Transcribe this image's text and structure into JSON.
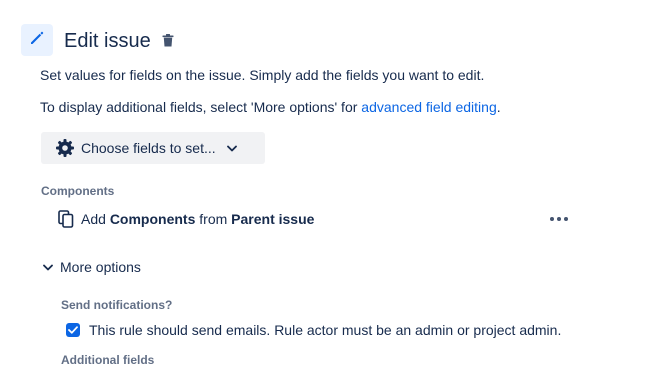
{
  "header": {
    "title": "Edit issue",
    "edit_icon": "pencil-icon",
    "delete_icon": "trash-icon"
  },
  "description": {
    "line1": "Set values for fields on the issue. Simply add the fields you want to edit.",
    "line2_prefix": "To display additional fields, select 'More options' for ",
    "line2_link": "advanced field editing",
    "line2_suffix": "."
  },
  "choose_fields": {
    "label": "Choose fields to set...",
    "icon": "gear-icon",
    "chevron": "chevron-down-icon"
  },
  "components": {
    "label": "Components",
    "row": {
      "prefix": "Add ",
      "field": "Components",
      "middle": " from ",
      "source": "Parent issue"
    },
    "row_icon": "copy-icon",
    "more_icon": "more-horizontal-icon"
  },
  "more_options": {
    "label": "More options",
    "expanded": true
  },
  "notifications": {
    "label": "Send notifications?",
    "checkbox_label": "This rule should send emails. Rule actor must be an admin or project admin.",
    "checked": true
  },
  "additional_fields": {
    "label": "Additional fields"
  },
  "colors": {
    "accent": "#0c66e4",
    "icon_bg": "#e9f2ff",
    "button_bg": "#f1f2f4",
    "text": "#172b4d",
    "subtle_text": "#626f86"
  }
}
